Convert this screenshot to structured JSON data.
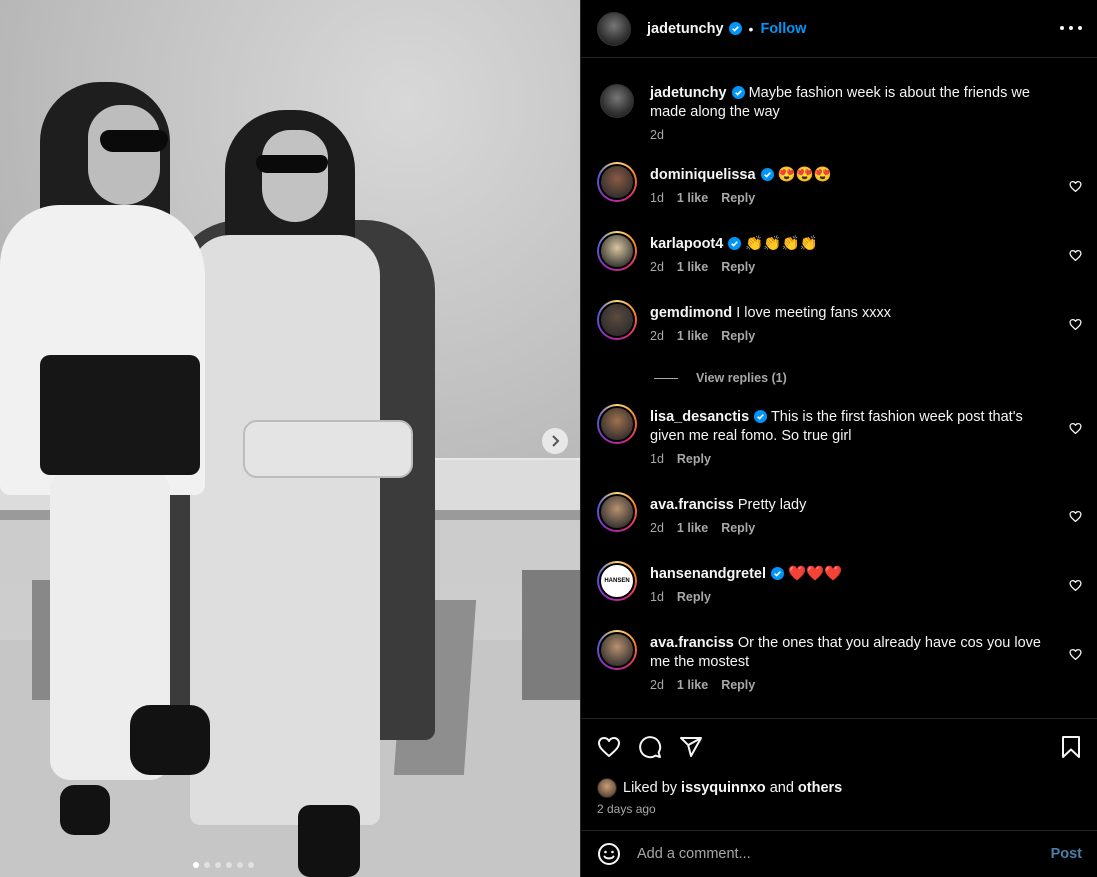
{
  "post": {
    "author": "jadetunchy",
    "follow_label": "Follow",
    "separator": "•",
    "caption": {
      "user": "jadetunchy",
      "text": "Maybe fashion week is about the friends we made along the way",
      "time": "2d"
    },
    "carousel": {
      "slide_count": 6,
      "active_index": 0
    }
  },
  "comments": [
    {
      "user": "dominiquelissa",
      "verified": true,
      "text": "😍😍😍",
      "time": "1d",
      "likes": "1 like",
      "reply": "Reply",
      "avatar_color": "#8a5a44"
    },
    {
      "user": "karlapoot4",
      "verified": true,
      "text": "👏👏👏👏",
      "time": "2d",
      "likes": "1 like",
      "reply": "Reply",
      "avatar_color": "#d9c6a0"
    },
    {
      "user": "gemdimond",
      "verified": false,
      "text": "I love meeting fans xxxx",
      "time": "2d",
      "likes": "1 like",
      "reply": "Reply",
      "avatar_color": "#5c4a40"
    },
    {
      "user": "lisa_desanctis",
      "verified": true,
      "text": "This is the first fashion week post that's given me real fomo. So true girl",
      "time": "1d",
      "likes": "",
      "reply": "Reply",
      "avatar_color": "#a0704e"
    },
    {
      "user": "ava.franciss",
      "verified": false,
      "text": "Pretty lady",
      "time": "2d",
      "likes": "1 like",
      "reply": "Reply",
      "avatar_color": "#b89170"
    },
    {
      "user": "hansenandgretel",
      "verified": true,
      "text": "❤️❤️❤️",
      "time": "1d",
      "likes": "",
      "reply": "Reply",
      "avatar_color": "#ffffff",
      "avatar_text": "HANSEN"
    },
    {
      "user": "ava.franciss",
      "verified": false,
      "text": "Or the ones that you already have cos you love me the mostest",
      "time": "2d",
      "likes": "1 like",
      "reply": "Reply",
      "avatar_color": "#b89170"
    }
  ],
  "view_replies": "View replies (1)",
  "likes": {
    "prefix": "Liked by",
    "user": "issyquinnxo",
    "middle": "and",
    "others": "others"
  },
  "time_ago": "2 days ago",
  "add_comment": {
    "placeholder": "Add a comment...",
    "post_label": "Post"
  },
  "colors": {
    "accent": "#0095f6",
    "verified": "#0095f6",
    "muted": "#a8a8a8"
  },
  "icons": [
    "heart-icon",
    "comment-icon",
    "share-icon",
    "bookmark-icon",
    "emoji-icon",
    "more-icon",
    "chevron-right-icon",
    "verified-icon"
  ]
}
